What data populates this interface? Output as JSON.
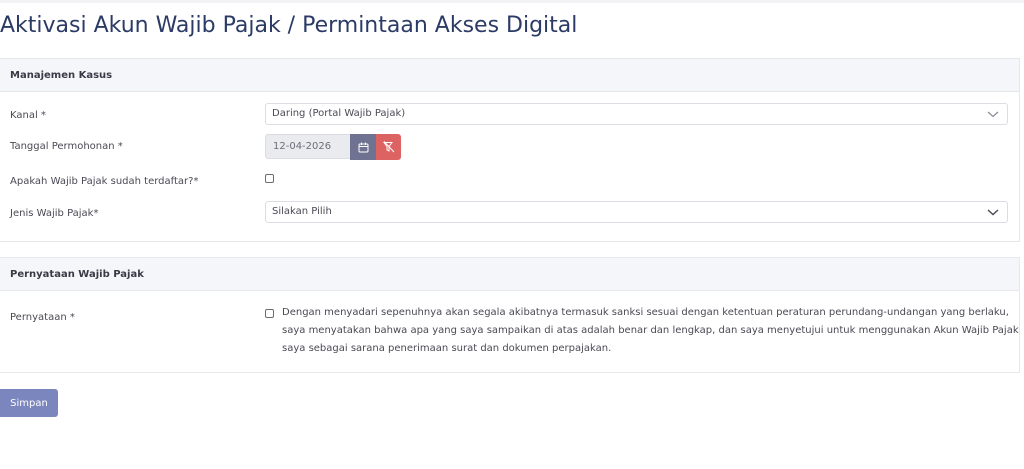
{
  "page": {
    "title": "Aktivasi Akun Wajib Pajak / Permintaan Akses Digital"
  },
  "case_management": {
    "header": "Manajemen Kasus",
    "channel": {
      "label": "Kanal *",
      "value": "Daring (Portal Wajib Pajak)"
    },
    "request_date": {
      "label": "Tanggal Permohonan *",
      "value": "12-04-2026",
      "calendar_icon": "calendar-icon",
      "clear_icon": "filter-clear-icon"
    },
    "registered": {
      "label": "Apakah Wajib Pajak sudah terdaftar?*",
      "checked": false
    },
    "taxpayer_type": {
      "label": "Jenis Wajib Pajak*",
      "value": "Silakan Pilih"
    }
  },
  "statement": {
    "header": "Pernyataan Wajib Pajak",
    "label": "Pernyataan *",
    "checked": false,
    "text": "Dengan menyadari sepenuhnya akan segala akibatnya termasuk sanksi sesuai dengan ketentuan peraturan perundang-undangan yang berlaku, saya menyatakan bahwa apa yang saya sampaikan di atas adalah benar dan lengkap, dan saya menyetujui untuk menggunakan Akun Wajib Pajak saya sebagai sarana penerimaan surat dan dokumen perpajakan."
  },
  "actions": {
    "save_label": "Simpan"
  },
  "colors": {
    "title": "#2b3b66",
    "calendar_button": "#6f7391",
    "clear_button": "#dd6363",
    "save_button": "#7b86be"
  }
}
